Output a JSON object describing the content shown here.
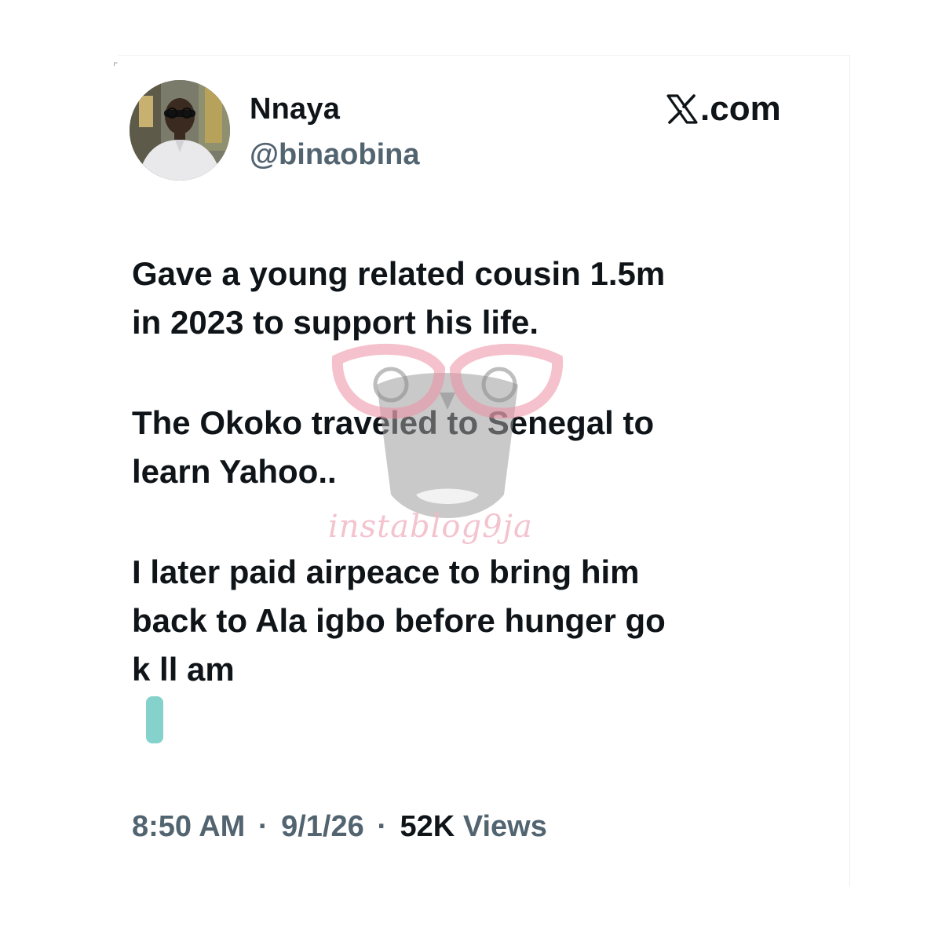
{
  "tweet": {
    "author": {
      "display_name": "Nnaya",
      "handle": "@binaobina",
      "avatar": "avatar-photo"
    },
    "source": {
      "label": ".com",
      "icon": "x-logo-icon"
    },
    "paragraphs": [
      "Gave a young related cousin 1.5m\nin 2023 to support his life.",
      "The Okoko traveled to Senegal to\nlearn Yahoo..",
      "I later paid airpeace to bring him\nback to Ala igbo before hunger go\nk ll am"
    ],
    "meta": {
      "time": "8:50 AM",
      "separator": "·",
      "date": "9/1/26",
      "views_count": "52K",
      "views_label": "Views"
    }
  },
  "watermark": {
    "text": "instablog9ja",
    "color": "#f1b9c6"
  },
  "colors": {
    "text_primary": "#0f1419",
    "text_secondary": "#536471",
    "censor": "#6fcac2"
  }
}
